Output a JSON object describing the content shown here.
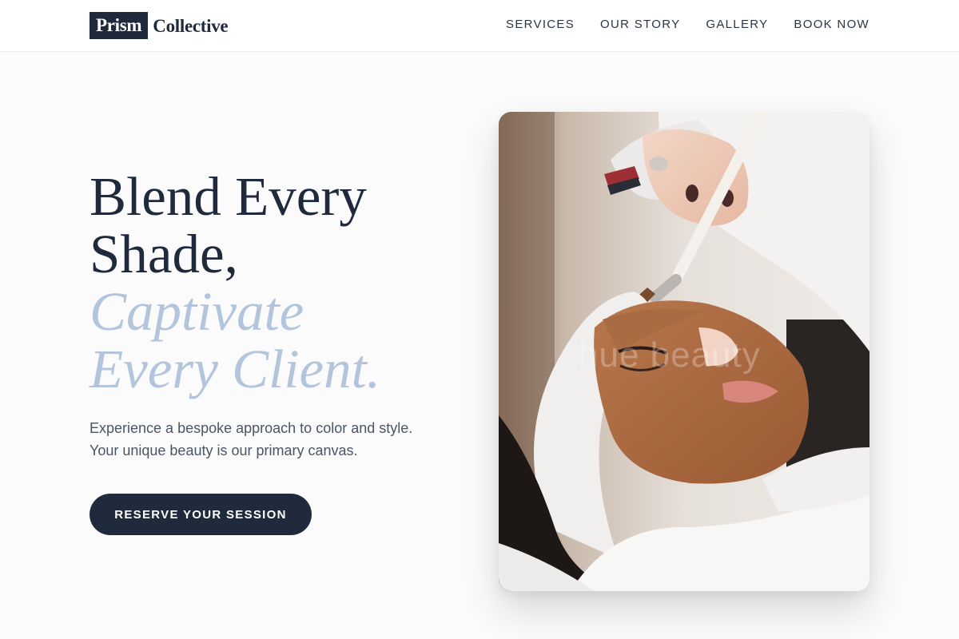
{
  "header": {
    "logo": {
      "box_text": "Prism",
      "text": "Collective"
    },
    "nav": [
      {
        "label": "SERVICES"
      },
      {
        "label": "OUR STORY"
      },
      {
        "label": "GALLERY"
      },
      {
        "label": "BOOK NOW"
      }
    ]
  },
  "hero": {
    "title_lines": [
      "Blend Every",
      "Shade,"
    ],
    "accent_lines": [
      "Captivate",
      "Every Client."
    ],
    "description_lines": [
      "Experience a bespoke approach to color and style.",
      "Your unique beauty is our primary canvas."
    ],
    "cta_label": "RESERVE YOUR SESSION",
    "image": {
      "watermark": "hue beauty"
    }
  },
  "colors": {
    "primary": "#1f2a3d",
    "accent": "#b3c5dc",
    "background": "#fbfbfb"
  }
}
